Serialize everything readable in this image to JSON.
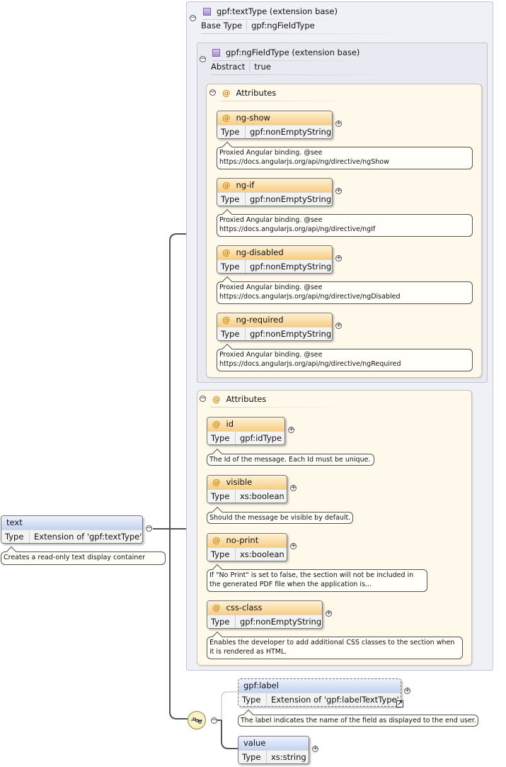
{
  "text_type_group": {
    "title": "gpf:textType (extension base)",
    "base_key": "Base Type",
    "base_value": "gpf:ngFieldType"
  },
  "ng_field_group": {
    "title": "gpf:ngFieldType (extension base)",
    "abstract_key": "Abstract",
    "abstract_value": "true"
  },
  "inner_attributes": {
    "label": "Attributes",
    "items": [
      {
        "name": "ng-show",
        "type_key": "Type",
        "type": "gpf:nonEmptyString",
        "note": "Proxied Angular binding. @see",
        "note2": "https://docs.angularjs.org/api/ng/directive/ngShow"
      },
      {
        "name": "ng-if",
        "type_key": "Type",
        "type": "gpf:nonEmptyString",
        "note": "Proxied Angular binding. @see",
        "note2": "https://docs.angularjs.org/api/ng/directive/ngIf"
      },
      {
        "name": "ng-disabled",
        "type_key": "Type",
        "type": "gpf:nonEmptyString",
        "note": "Proxied Angular binding. @see",
        "note2": "https://docs.angularjs.org/api/ng/directive/ngDisabled"
      },
      {
        "name": "ng-required",
        "type_key": "Type",
        "type": "gpf:nonEmptyString",
        "note": "Proxied Angular binding. @see",
        "note2": "https://docs.angularjs.org/api/ng/directive/ngRequired"
      }
    ]
  },
  "outer_attributes": {
    "label": "Attributes",
    "items": [
      {
        "name": "id",
        "type_key": "Type",
        "type": "gpf:idType",
        "note": "The Id of the message. Each Id must be unique.",
        "note2": ""
      },
      {
        "name": "visible",
        "type_key": "Type",
        "type": "xs:boolean",
        "note": "Should the message be visible by default.",
        "note2": ""
      },
      {
        "name": "no-print",
        "type_key": "Type",
        "type": "xs:boolean",
        "note": "If \"No Print\" is set to false, the section will not be included in",
        "note2": "the generated PDF file when the application is..."
      },
      {
        "name": "css-class",
        "type_key": "Type",
        "type": "gpf:nonEmptyString",
        "note": "Enables the developer to add additional CSS classes to the section when",
        "note2": "it is rendered as HTML."
      }
    ]
  },
  "root_element": {
    "name": "text",
    "type_key": "Type",
    "type": "Extension of 'gpf:textType'",
    "note": "Creates a read-only text display container"
  },
  "label_element": {
    "name": "gpf:label",
    "type_key": "Type",
    "type": "Extension of 'gpf:labelTextType'",
    "note": "The label indicates the name of the field as displayed to the end user."
  },
  "value_element": {
    "name": "value",
    "type_key": "Type",
    "type": "xs:string"
  },
  "symbols": {
    "collapse": "−",
    "expand": "+",
    "attribute_marker": "@",
    "link_arrow": "↗"
  }
}
